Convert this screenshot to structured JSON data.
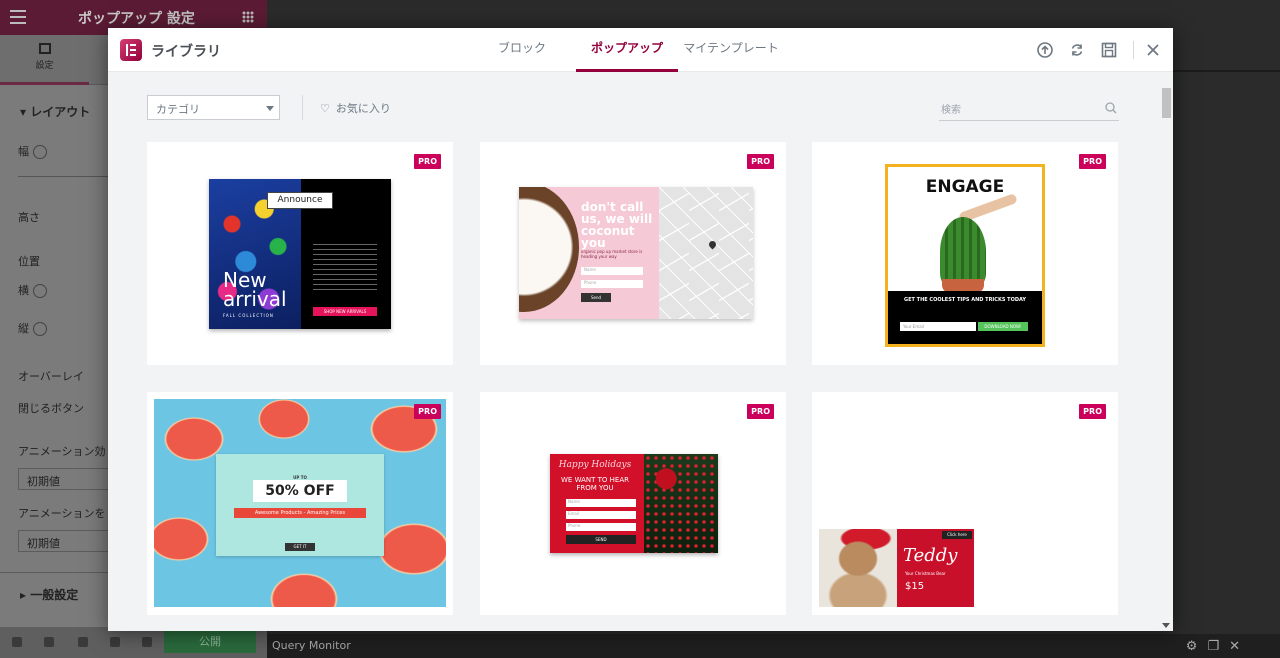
{
  "background": {
    "panel_title": "ポップアップ 設定",
    "tab_label": "設定",
    "section_layout": "レイアウト",
    "width_label": "幅",
    "height_label": "高さ",
    "position_label": "位置",
    "horizontal_label": "横",
    "vertical_label": "縦",
    "overlay_label": "オーバーレイ",
    "close_button_label": "閉じるボタン",
    "entrance_animation_label": "アニメーション効",
    "entrance_default": "初期値",
    "exit_animation_label": "アニメーションを",
    "exit_default": "初期値",
    "general_settings": "一般設定",
    "publish_label": "公開",
    "query_monitor": "Query Monitor"
  },
  "library": {
    "title": "ライブラリ",
    "tabs": [
      {
        "label": "ブロック",
        "active": false
      },
      {
        "label": "ポップアップ",
        "active": true
      },
      {
        "label": "マイテンプレート",
        "active": false
      }
    ],
    "header_icons": [
      "upload-icon",
      "sync-icon",
      "save-icon",
      "close-icon"
    ],
    "filter": {
      "category_placeholder": "カテゴリ",
      "favorites_label": "お気に入り",
      "search_placeholder": "検索"
    },
    "accent_color": "#93003c",
    "pro_color": "#ca005b"
  },
  "templates": [
    {
      "badge": "PRO",
      "texts": {
        "announce": "Announce",
        "new": "New",
        "arrival": "arrival",
        "collection": "FALL COLLECTION",
        "cta": "SHOP NEW ARRIVALS"
      }
    },
    {
      "badge": "PRO",
      "texts": {
        "headline": "don't call us, we will coconut you",
        "sub": "organic pop up market store is heading your way",
        "name": "Name",
        "phone": "Phone",
        "send": "Send"
      }
    },
    {
      "badge": "PRO",
      "texts": {
        "headline": "ENGAGE",
        "sub": "GET THE COOLEST TIPS AND TRICKS TODAY",
        "email": "Your Email",
        "cta": "DOWNLOAD NOW!"
      }
    },
    {
      "badge": "PRO",
      "texts": {
        "upto": "UP TO",
        "offer": "50% OFF",
        "ribbon": "Awesome Products - Amazing Prices",
        "cta": "GET IT"
      }
    },
    {
      "badge": "PRO",
      "texts": {
        "script": "Happy Holidays",
        "headline": "WE WANT TO HEAR FROM YOU",
        "name": "Name",
        "email": "Email",
        "phone": "Phone",
        "send": "SEND"
      }
    },
    {
      "badge": "PRO",
      "texts": {
        "script": "Teddy",
        "sub": "Your Christmas Bear",
        "price": "$15",
        "cta": "Click here"
      }
    }
  ]
}
